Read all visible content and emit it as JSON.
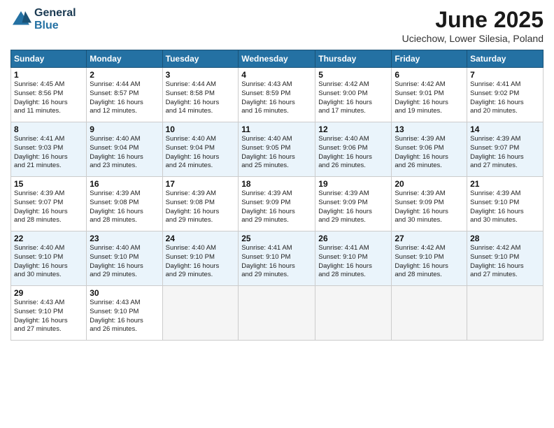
{
  "header": {
    "logo_line1": "General",
    "logo_line2": "Blue",
    "month": "June 2025",
    "location": "Uciechow, Lower Silesia, Poland"
  },
  "weekdays": [
    "Sunday",
    "Monday",
    "Tuesday",
    "Wednesday",
    "Thursday",
    "Friday",
    "Saturday"
  ],
  "weeks": [
    [
      {
        "day": "1",
        "info": "Sunrise: 4:45 AM\nSunset: 8:56 PM\nDaylight: 16 hours\nand 11 minutes."
      },
      {
        "day": "2",
        "info": "Sunrise: 4:44 AM\nSunset: 8:57 PM\nDaylight: 16 hours\nand 12 minutes."
      },
      {
        "day": "3",
        "info": "Sunrise: 4:44 AM\nSunset: 8:58 PM\nDaylight: 16 hours\nand 14 minutes."
      },
      {
        "day": "4",
        "info": "Sunrise: 4:43 AM\nSunset: 8:59 PM\nDaylight: 16 hours\nand 16 minutes."
      },
      {
        "day": "5",
        "info": "Sunrise: 4:42 AM\nSunset: 9:00 PM\nDaylight: 16 hours\nand 17 minutes."
      },
      {
        "day": "6",
        "info": "Sunrise: 4:42 AM\nSunset: 9:01 PM\nDaylight: 16 hours\nand 19 minutes."
      },
      {
        "day": "7",
        "info": "Sunrise: 4:41 AM\nSunset: 9:02 PM\nDaylight: 16 hours\nand 20 minutes."
      }
    ],
    [
      {
        "day": "8",
        "info": "Sunrise: 4:41 AM\nSunset: 9:03 PM\nDaylight: 16 hours\nand 21 minutes."
      },
      {
        "day": "9",
        "info": "Sunrise: 4:40 AM\nSunset: 9:04 PM\nDaylight: 16 hours\nand 23 minutes."
      },
      {
        "day": "10",
        "info": "Sunrise: 4:40 AM\nSunset: 9:04 PM\nDaylight: 16 hours\nand 24 minutes."
      },
      {
        "day": "11",
        "info": "Sunrise: 4:40 AM\nSunset: 9:05 PM\nDaylight: 16 hours\nand 25 minutes."
      },
      {
        "day": "12",
        "info": "Sunrise: 4:40 AM\nSunset: 9:06 PM\nDaylight: 16 hours\nand 26 minutes."
      },
      {
        "day": "13",
        "info": "Sunrise: 4:39 AM\nSunset: 9:06 PM\nDaylight: 16 hours\nand 26 minutes."
      },
      {
        "day": "14",
        "info": "Sunrise: 4:39 AM\nSunset: 9:07 PM\nDaylight: 16 hours\nand 27 minutes."
      }
    ],
    [
      {
        "day": "15",
        "info": "Sunrise: 4:39 AM\nSunset: 9:07 PM\nDaylight: 16 hours\nand 28 minutes."
      },
      {
        "day": "16",
        "info": "Sunrise: 4:39 AM\nSunset: 9:08 PM\nDaylight: 16 hours\nand 28 minutes."
      },
      {
        "day": "17",
        "info": "Sunrise: 4:39 AM\nSunset: 9:08 PM\nDaylight: 16 hours\nand 29 minutes."
      },
      {
        "day": "18",
        "info": "Sunrise: 4:39 AM\nSunset: 9:09 PM\nDaylight: 16 hours\nand 29 minutes."
      },
      {
        "day": "19",
        "info": "Sunrise: 4:39 AM\nSunset: 9:09 PM\nDaylight: 16 hours\nand 29 minutes."
      },
      {
        "day": "20",
        "info": "Sunrise: 4:39 AM\nSunset: 9:09 PM\nDaylight: 16 hours\nand 30 minutes."
      },
      {
        "day": "21",
        "info": "Sunrise: 4:39 AM\nSunset: 9:10 PM\nDaylight: 16 hours\nand 30 minutes."
      }
    ],
    [
      {
        "day": "22",
        "info": "Sunrise: 4:40 AM\nSunset: 9:10 PM\nDaylight: 16 hours\nand 30 minutes."
      },
      {
        "day": "23",
        "info": "Sunrise: 4:40 AM\nSunset: 9:10 PM\nDaylight: 16 hours\nand 29 minutes."
      },
      {
        "day": "24",
        "info": "Sunrise: 4:40 AM\nSunset: 9:10 PM\nDaylight: 16 hours\nand 29 minutes."
      },
      {
        "day": "25",
        "info": "Sunrise: 4:41 AM\nSunset: 9:10 PM\nDaylight: 16 hours\nand 29 minutes."
      },
      {
        "day": "26",
        "info": "Sunrise: 4:41 AM\nSunset: 9:10 PM\nDaylight: 16 hours\nand 28 minutes."
      },
      {
        "day": "27",
        "info": "Sunrise: 4:42 AM\nSunset: 9:10 PM\nDaylight: 16 hours\nand 28 minutes."
      },
      {
        "day": "28",
        "info": "Sunrise: 4:42 AM\nSunset: 9:10 PM\nDaylight: 16 hours\nand 27 minutes."
      }
    ],
    [
      {
        "day": "29",
        "info": "Sunrise: 4:43 AM\nSunset: 9:10 PM\nDaylight: 16 hours\nand 27 minutes."
      },
      {
        "day": "30",
        "info": "Sunrise: 4:43 AM\nSunset: 9:10 PM\nDaylight: 16 hours\nand 26 minutes."
      },
      {
        "day": "",
        "info": ""
      },
      {
        "day": "",
        "info": ""
      },
      {
        "day": "",
        "info": ""
      },
      {
        "day": "",
        "info": ""
      },
      {
        "day": "",
        "info": ""
      }
    ]
  ]
}
